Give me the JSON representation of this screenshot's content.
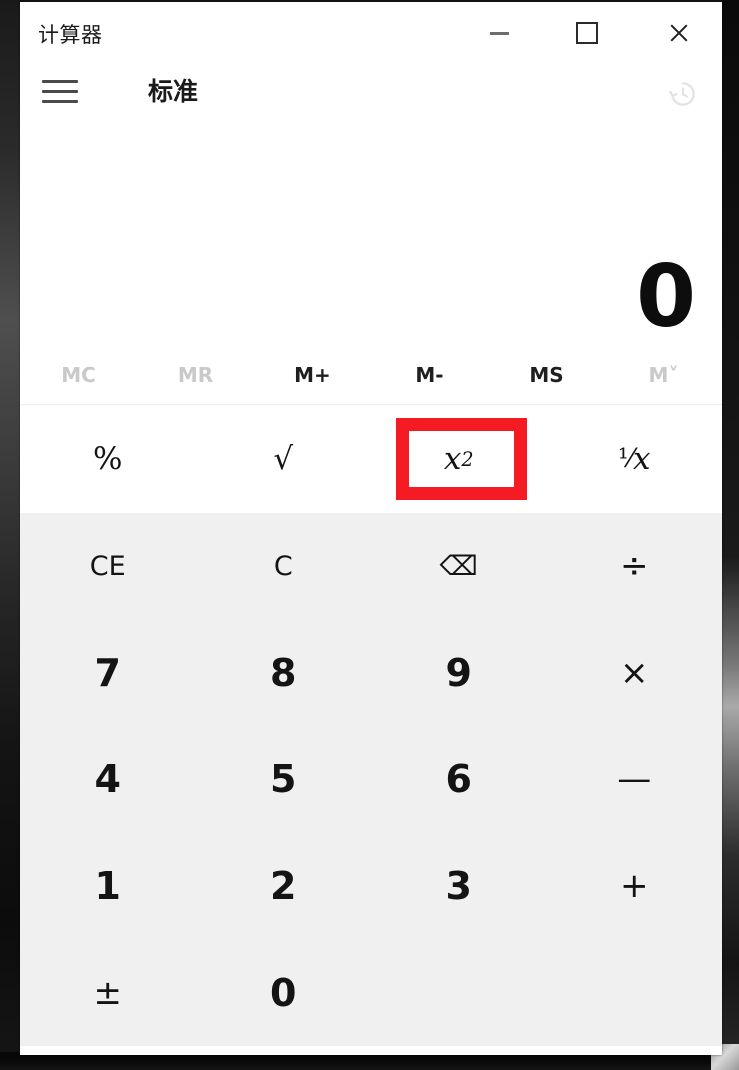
{
  "window": {
    "app_title": "计算器",
    "caption": {
      "minimize": "minimize-icon",
      "maximize": "maximize-icon",
      "close": "close-icon"
    }
  },
  "modebar": {
    "menu_icon": "hamburger-menu-icon",
    "mode_label": "标准",
    "history_icon": "history-clock-icon"
  },
  "display": {
    "value": "0"
  },
  "memory": {
    "buttons": [
      {
        "label": "MC",
        "enabled": false
      },
      {
        "label": "MR",
        "enabled": false
      },
      {
        "label": "M+",
        "enabled": true
      },
      {
        "label": "M-",
        "enabled": true
      },
      {
        "label": "MS",
        "enabled": true
      },
      {
        "label": "M˅",
        "enabled": false
      }
    ]
  },
  "functions": {
    "percent": "%",
    "sqrt": "√",
    "square_base": "x",
    "square_exp": "2",
    "reciprocal_num": "¹",
    "reciprocal_slash": "⁄",
    "reciprocal_den": "x"
  },
  "annotation": {
    "color": "#f51b22",
    "target": "sqrt"
  },
  "keypad": {
    "rows": [
      [
        {
          "label": "CE",
          "kind": "small"
        },
        {
          "label": "C",
          "kind": "small"
        },
        {
          "label": "⌫",
          "kind": "small"
        },
        {
          "label": "÷",
          "kind": "op"
        }
      ],
      [
        {
          "label": "7",
          "kind": "digit"
        },
        {
          "label": "8",
          "kind": "digit"
        },
        {
          "label": "9",
          "kind": "digit"
        },
        {
          "label": "×",
          "kind": "op"
        }
      ],
      [
        {
          "label": "4",
          "kind": "digit"
        },
        {
          "label": "5",
          "kind": "digit"
        },
        {
          "label": "6",
          "kind": "digit"
        },
        {
          "label": "—",
          "kind": "op"
        }
      ],
      [
        {
          "label": "1",
          "kind": "digit"
        },
        {
          "label": "2",
          "kind": "digit"
        },
        {
          "label": "3",
          "kind": "digit"
        },
        {
          "label": "+",
          "kind": "op"
        }
      ],
      [
        {
          "label": "±",
          "kind": "op"
        },
        {
          "label": "0",
          "kind": "digit"
        },
        {
          "label": "",
          "kind": "blank"
        },
        {
          "label": "",
          "kind": "blank"
        }
      ]
    ]
  }
}
